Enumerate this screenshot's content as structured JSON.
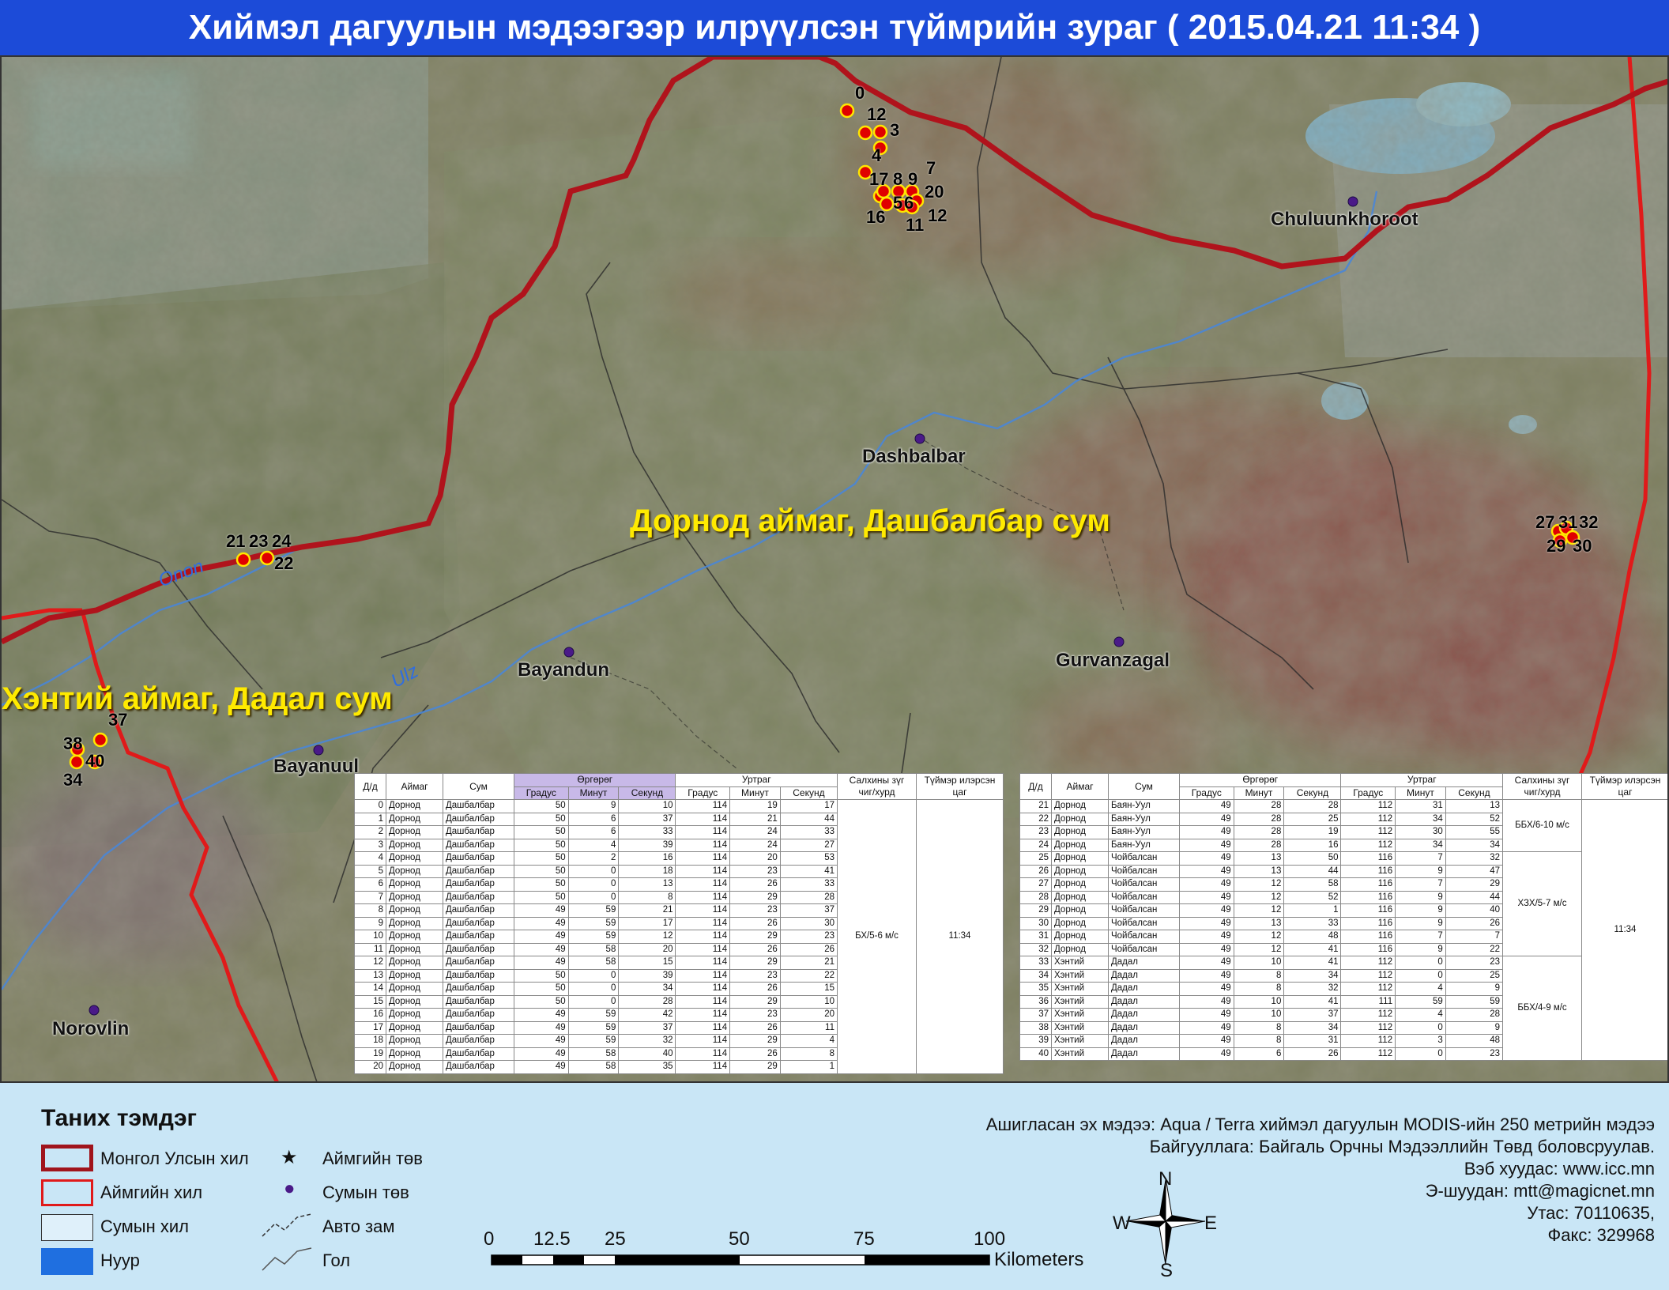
{
  "title": "Хиймэл дагуулын мэдээгээр илрүүлсэн түймрийн зураг  ( 2015.04.21 11:34 )",
  "map": {
    "region_labels": [
      {
        "id": "dornod",
        "text": "Дорнод аймаг, Дашбалбар сум"
      },
      {
        "id": "khentii",
        "text": "Хэнтий аймаг, Дадал сум"
      }
    ],
    "towns": [
      {
        "id": "chuluunkhoroot",
        "text": "Chuluunkhoroot"
      },
      {
        "id": "dashbalbar",
        "text": "Dashbalbar"
      },
      {
        "id": "bayandun",
        "text": "Bayandun"
      },
      {
        "id": "gurvanzagal",
        "text": "Gurvanzagal"
      },
      {
        "id": "bayanuul",
        "text": "Bayanuul"
      },
      {
        "id": "norovlin",
        "text": "Norovlin"
      }
    ],
    "rivers": [
      {
        "id": "onon",
        "text": "Onon"
      },
      {
        "id": "ulz",
        "text": "Ulz"
      }
    ],
    "fire_labels": [
      "0",
      "12",
      "3",
      "4",
      "17",
      "8",
      "9",
      "7",
      "20",
      "5",
      "6",
      "16",
      "11",
      "12",
      "21",
      "23",
      "24",
      "22",
      "27",
      "31",
      "32",
      "29",
      "30",
      "37",
      "38",
      "40",
      "34"
    ]
  },
  "table_left": {
    "headers": {
      "id": "Д/д",
      "aimag": "Аймаг",
      "sum": "Сум",
      "lat": "Өргөрөг",
      "lon": "Уртраг",
      "deg": "Градус",
      "min": "Минут",
      "sec": "Секунд",
      "wind": "Салхины зүг чиг/хурд",
      "time": "Түймэр илэрсэн цаг"
    },
    "rows": [
      [
        "0",
        "Дорнод",
        "Дашбалбар",
        "50",
        "9",
        "10",
        "114",
        "19",
        "17"
      ],
      [
        "1",
        "Дорнод",
        "Дашбалбар",
        "50",
        "6",
        "37",
        "114",
        "21",
        "44"
      ],
      [
        "2",
        "Дорнод",
        "Дашбалбар",
        "50",
        "6",
        "33",
        "114",
        "24",
        "33"
      ],
      [
        "3",
        "Дорнод",
        "Дашбалбар",
        "50",
        "4",
        "39",
        "114",
        "24",
        "27"
      ],
      [
        "4",
        "Дорнод",
        "Дашбалбар",
        "50",
        "2",
        "16",
        "114",
        "20",
        "53"
      ],
      [
        "5",
        "Дорнод",
        "Дашбалбар",
        "50",
        "0",
        "18",
        "114",
        "23",
        "41"
      ],
      [
        "6",
        "Дорнод",
        "Дашбалбар",
        "50",
        "0",
        "13",
        "114",
        "26",
        "33"
      ],
      [
        "7",
        "Дорнод",
        "Дашбалбар",
        "50",
        "0",
        "8",
        "114",
        "29",
        "28"
      ],
      [
        "8",
        "Дорнод",
        "Дашбалбар",
        "49",
        "59",
        "21",
        "114",
        "23",
        "37"
      ],
      [
        "9",
        "Дорнод",
        "Дашбалбар",
        "49",
        "59",
        "17",
        "114",
        "26",
        "30"
      ],
      [
        "10",
        "Дорнод",
        "Дашбалбар",
        "49",
        "59",
        "12",
        "114",
        "29",
        "23"
      ],
      [
        "11",
        "Дорнод",
        "Дашбалбар",
        "49",
        "58",
        "20",
        "114",
        "26",
        "26"
      ],
      [
        "12",
        "Дорнод",
        "Дашбалбар",
        "49",
        "58",
        "15",
        "114",
        "29",
        "21"
      ],
      [
        "13",
        "Дорнод",
        "Дашбалбар",
        "50",
        "0",
        "39",
        "114",
        "23",
        "22"
      ],
      [
        "14",
        "Дорнод",
        "Дашбалбар",
        "50",
        "0",
        "34",
        "114",
        "26",
        "15"
      ],
      [
        "15",
        "Дорнод",
        "Дашбалбар",
        "50",
        "0",
        "28",
        "114",
        "29",
        "10"
      ],
      [
        "16",
        "Дорнод",
        "Дашбалбар",
        "49",
        "59",
        "42",
        "114",
        "23",
        "20"
      ],
      [
        "17",
        "Дорнод",
        "Дашбалбар",
        "49",
        "59",
        "37",
        "114",
        "26",
        "11"
      ],
      [
        "18",
        "Дорнод",
        "Дашбалбар",
        "49",
        "59",
        "32",
        "114",
        "29",
        "4"
      ],
      [
        "19",
        "Дорнод",
        "Дашбалбар",
        "49",
        "58",
        "40",
        "114",
        "26",
        "8"
      ],
      [
        "20",
        "Дорнод",
        "Дашбалбар",
        "49",
        "58",
        "35",
        "114",
        "29",
        "1"
      ]
    ],
    "wind": "БХ/5-6 м/с",
    "time": "11:34"
  },
  "table_right": {
    "headers": {
      "id": "Д/д",
      "aimag": "Аймаг",
      "sum": "Сум",
      "lat": "Өргөрөг",
      "lon": "Уртраг",
      "deg": "Градус",
      "min": "Минут",
      "sec": "Секунд",
      "wind": "Салхины зүг чиг/хурд",
      "time": "Түймэр илэрсэн цаг"
    },
    "rows": [
      [
        "21",
        "Дорнод",
        "Баян-Уул",
        "49",
        "28",
        "28",
        "112",
        "31",
        "13"
      ],
      [
        "22",
        "Дорнод",
        "Баян-Уул",
        "49",
        "28",
        "25",
        "112",
        "34",
        "52"
      ],
      [
        "23",
        "Дорнод",
        "Баян-Уул",
        "49",
        "28",
        "19",
        "112",
        "30",
        "55"
      ],
      [
        "24",
        "Дорнод",
        "Баян-Уул",
        "49",
        "28",
        "16",
        "112",
        "34",
        "34"
      ],
      [
        "25",
        "Дорнод",
        "Чойбалсан",
        "49",
        "13",
        "50",
        "116",
        "7",
        "32"
      ],
      [
        "26",
        "Дорнод",
        "Чойбалсан",
        "49",
        "13",
        "44",
        "116",
        "9",
        "47"
      ],
      [
        "27",
        "Дорнод",
        "Чойбалсан",
        "49",
        "12",
        "58",
        "116",
        "7",
        "29"
      ],
      [
        "28",
        "Дорнод",
        "Чойбалсан",
        "49",
        "12",
        "52",
        "116",
        "9",
        "44"
      ],
      [
        "29",
        "Дорнод",
        "Чойбалсан",
        "49",
        "12",
        "1",
        "116",
        "9",
        "40"
      ],
      [
        "30",
        "Дорнод",
        "Чойбалсан",
        "49",
        "13",
        "33",
        "116",
        "9",
        "26"
      ],
      [
        "31",
        "Дорнод",
        "Чойбалсан",
        "49",
        "12",
        "48",
        "116",
        "7",
        "7"
      ],
      [
        "32",
        "Дорнод",
        "Чойбалсан",
        "49",
        "12",
        "41",
        "116",
        "9",
        "22"
      ],
      [
        "33",
        "Хэнтий",
        "Дадал",
        "49",
        "10",
        "41",
        "112",
        "0",
        "23"
      ],
      [
        "34",
        "Хэнтий",
        "Дадал",
        "49",
        "8",
        "34",
        "112",
        "0",
        "25"
      ],
      [
        "35",
        "Хэнтий",
        "Дадал",
        "49",
        "8",
        "32",
        "112",
        "4",
        "9"
      ],
      [
        "36",
        "Хэнтий",
        "Дадал",
        "49",
        "10",
        "41",
        "111",
        "59",
        "59"
      ],
      [
        "37",
        "Хэнтий",
        "Дадал",
        "49",
        "10",
        "37",
        "112",
        "4",
        "28"
      ],
      [
        "38",
        "Хэнтий",
        "Дадал",
        "49",
        "8",
        "34",
        "112",
        "0",
        "9"
      ],
      [
        "39",
        "Хэнтий",
        "Дадал",
        "49",
        "8",
        "31",
        "112",
        "3",
        "48"
      ],
      [
        "40",
        "Хэнтий",
        "Дадал",
        "49",
        "6",
        "26",
        "112",
        "0",
        "23"
      ]
    ],
    "winds": [
      "ББХ/6-10 м/с",
      "ХЗХ/5-7 м/с",
      "ББХ/4-9 м/с"
    ],
    "time": "11:34"
  },
  "legend": {
    "title": "Таних тэмдэг",
    "items": {
      "border_country": "Монгол Улсын хил",
      "border_aimag": "Аймгийн хил",
      "border_sum": "Сумын хил",
      "lake": "Нуур",
      "aimag_center": "Аймгийн төв",
      "sum_center": "Сумын төв",
      "road": "Авто зам",
      "river": "Гол"
    }
  },
  "scalebar": {
    "ticks": [
      "0",
      "12.5",
      "25",
      "50",
      "75",
      "100"
    ],
    "unit": "Kilometers"
  },
  "compass": {
    "n": "N",
    "s": "S",
    "e": "E",
    "w": "W"
  },
  "source": [
    "Ашигласан эх мэдээ: Aqua / Terra хиймэл дагуулын MODIS-ийн 250 метрийн мэдээ",
    "Байгууллага: Байгаль Орчны Мэдээллийн Төвд боловсруулав.",
    "Вэб хуудас: www.icc.mn",
    "Э-шуудан: mtt@magicnet.mn",
    "Утас: 70110635,",
    "Факс: 329968"
  ],
  "colors": {
    "title_bg": "#1c4bd8",
    "country_border": "#b0131c",
    "aimag_border": "#e01a1a",
    "fire": "#e00000",
    "bottom_bg": "#c9e6f6",
    "region_label": "#ffea00"
  }
}
